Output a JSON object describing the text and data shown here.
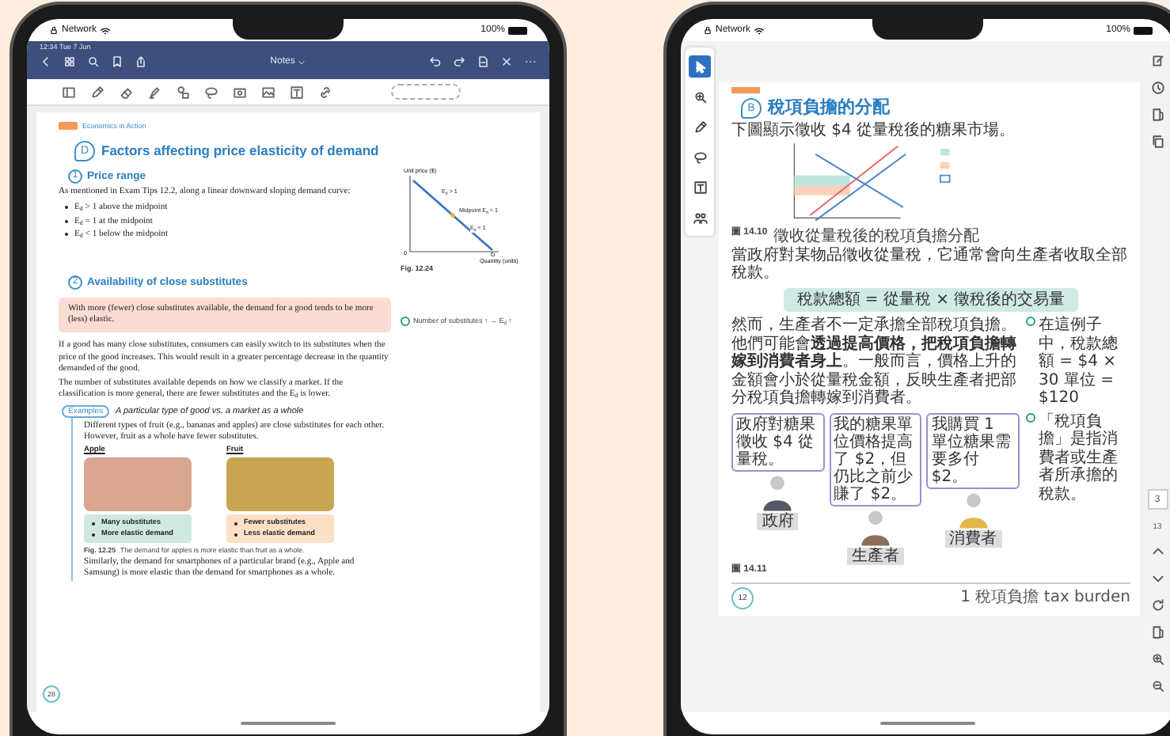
{
  "left_tablet": {
    "status_bar": {
      "network": "Network",
      "battery": "100%"
    },
    "app_bar": {
      "time": "12:34  Tue 7 Jun",
      "title": "Notes"
    },
    "page": {
      "tag": "Economics in Action",
      "heading_letter": "D",
      "heading": "Factors affecting price elasticity of demand",
      "sections": [
        {
          "number": "1",
          "title": "Price range"
        },
        {
          "number": "2",
          "title": "Availability of close substitutes"
        }
      ],
      "intro": "As mentioned in Exam Tips 12.2, along a linear downward sloping demand curve:",
      "bullets": [
        "E$_{d}$ > 1 above the midpoint",
        "E$_{d}$ = 1 at the midpoint",
        "E$_{d}$ < 1 below the midpoint"
      ],
      "diagram": {
        "y_axis": "Unit price ($)",
        "x_axis": "Quantity (units)",
        "origin": "0",
        "curve": "D",
        "upper": "E$_{d}$ > 1",
        "mid": "Midpoint E$_{d}$ = 1",
        "lower": "E$_{d}$ < 1",
        "caption": "Fig. 12.24"
      },
      "highlight": "With more (fewer) close substitutes available, the demand for a good tends to be more (less) elastic.",
      "side_note": "Number of substitutes ↑ → E$_{d}$ ↑",
      "paragraphs": [
        "If a good has many close substitutes, consumers can easily switch to its substitutes when the price of the good increases. This would result in a greater percentage decrease in the quantity demanded of the good.",
        "The number of substitutes available depends on how we classify a market. If the classification is more general, there are fewer substitutes and the E$_{d}$ is lower."
      ],
      "example": {
        "tag": "Examples",
        "title": "A particular type of good vs. a market as a whole",
        "text": "Different types of fruit (e.g., bananas and apples) are close substitutes for each other. However, fruit as a whole have fewer substitutes.",
        "columns": [
          {
            "label": "Apple",
            "points": [
              "Many substitutes",
              "More elastic demand"
            ],
            "color": "#cfe9e2"
          },
          {
            "label": "Fruit",
            "points": [
              "Fewer substitutes",
              "Less elastic demand"
            ],
            "color": "#fbe0c6"
          }
        ],
        "caption_label": "Fig. 12.25",
        "caption": "The demand for apples is more elastic than fruit as a whole.",
        "closing": "Similarly, the demand for smartphones of a particular brand (e.g., Apple and Samsung) is more elastic than the demand for smartphones as a whole."
      },
      "page_number": "28"
    }
  },
  "right_tablet": {
    "status_bar": {
      "network": "Network",
      "battery": "100%"
    },
    "tools": [
      {
        "selected": true
      },
      {
        "selected": false
      },
      {
        "selected": false
      },
      {
        "selected": false
      },
      {
        "selected": false
      },
      {
        "selected": false
      }
    ],
    "page_box": "3",
    "page_count": "13",
    "page": {
      "heading_letter": "B",
      "heading": "稅項負擔的分配",
      "intro": "下圖顯示徵收 $4 從量稅後的糖果市場。",
      "fig1": "圖 14.10",
      "fig1_caption": "徵收從量稅後的稅項負擔分配",
      "text1": "當政府對某物品徵收從量稅，它通常會向生產者收取全部稅款。",
      "formula": "稅款總額 = 從量稅 × 徵稅後的交易量",
      "text2": "然而，生產者不一定承擔全部稅項負擔。他們可能會**透過提高價格，把稅項負擔轉嫁到消費者身上**。一般而言，價格上升的金額會小於從量稅金額，反映生產者把部分稅項負擔轉嫁到消費者。",
      "notes": [
        "在這例子中，稅款總額 = $4 × 30 單位 = $120",
        "「稅項負擔」是指消費者或生產者所承擔的稅款。"
      ],
      "people": [
        {
          "speech": "政府對糖果徵收 $4 從量稅。",
          "label": "政府"
        },
        {
          "speech": "我的糖果單位價格提高了 $2，但仍比之前少賺了 $2。",
          "label": "生產者"
        },
        {
          "speech": "我購買 1 單位糖果需要多付 $2。",
          "label": "消費者"
        }
      ],
      "fig2": "圖 14.11",
      "footnote": "1 稅項負擔 tax burden",
      "page_number": "12"
    }
  }
}
